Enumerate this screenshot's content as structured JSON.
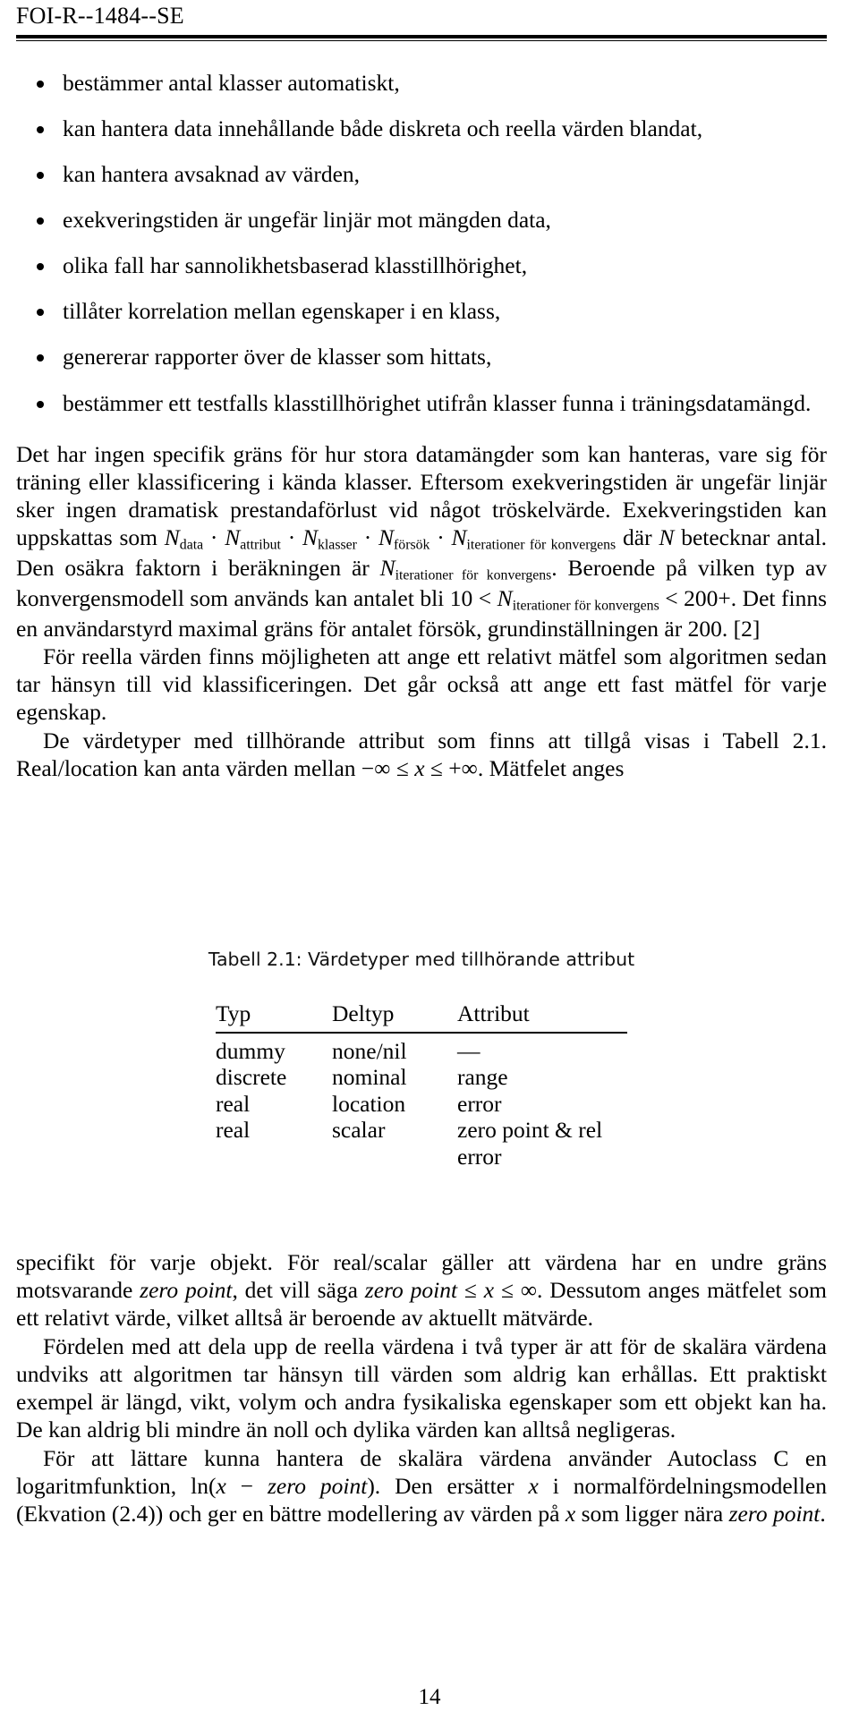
{
  "header": {
    "report_id": "FOI-R--1484--SE"
  },
  "bullets": [
    "bestämmer antal klasser automatiskt,",
    "kan hantera data innehållande både diskreta och reella värden blandat,",
    "kan hantera avsaknad av värden,",
    "exekveringstiden är ungefär linjär mot mängden data,",
    "olika fall har sannolikhetsbaserad klasstillhörighet,",
    "tillåter korrelation mellan egenskaper i en klass,",
    "genererar rapporter över de klasser som hittats,",
    "bestämmer ett testfalls klasstillhörighet utifrån klasser funna i träningsdatamängd."
  ],
  "paragraphs": {
    "p1_a": "Det har ingen specifik gräns för hur stora datamängder som kan hanteras, vare sig för träning eller klassificering i kända klasser. Eftersom exekveringstiden är ungefär linjär sker ingen dramatisk prestandaförlust vid något tröskelvärde. Exekveringstiden kan uppskattas som ",
    "p1_b": " där ",
    "p1_c": " betecknar antal. Den osäkra faktorn i beräkningen är ",
    "p1_d": ". Beroende på vilken typ av konvergensmodell som används kan antalet bli 10 < ",
    "p1_e": " < 200+. Det finns en användarstyrd maximal gräns för antalet försök, grundinställningen är 200. [2]",
    "p2": "För reella värden finns möjligheten att ange ett relativt mätfel som algoritmen sedan tar hänsyn till vid klassificeringen. Det går också att ange ett fast mätfel för varje egenskap.",
    "p3_a": "De värdetyper med tillhörande attribut som finns att tillgå visas i Tabell 2.1. Real/location kan anta värden mellan −∞ ≤ ",
    "p3_b": " ≤ +∞. Mätfelet anges",
    "p4_a": "specifikt för varje objekt. För real/scalar gäller att värdena har en undre gräns motsvarande ",
    "p4_b": ", det vill säga ",
    "p4_c": " ≤ ",
    "p4_d": " ≤ ∞. Dessutom anges mätfelet som ett relativt värde, vilket alltså är beroende av aktuellt mätvärde.",
    "p5": "Fördelen med att dela upp de reella värdena i två typer är att för de skalära värdena undviks att algoritmen tar hänsyn till värden som aldrig kan erhållas. Ett praktiskt exempel är längd, vikt, volym och andra fysikaliska egenskaper som ett objekt kan ha. De kan aldrig bli mindre än noll och dylika värden kan alltså negligeras.",
    "p6_a": "För att lättare kunna hantera de skalära värdena använder Autoclass C en logaritmfunktion, ln(",
    "p6_b": " − ",
    "p6_c": "). Den ersätter ",
    "p6_d": " i normalfördelningsmodellen (Ekvation (2.4)) och ger en bättre modellering av värden på ",
    "p6_e": " som ligger nära ",
    "p6_f": "."
  },
  "math": {
    "N": "N",
    "x": "x",
    "dot": "·",
    "zero_point": "zero point",
    "sub_data": "data",
    "sub_attribut": "attribut",
    "sub_klasser": "klasser",
    "sub_forsok": "försök",
    "sub_iterationer": "iterationer för konvergens"
  },
  "table": {
    "caption": "Tabell 2.1: Värdetyper med tillhörande attribut",
    "columns": [
      "Typ",
      "Deltyp",
      "Attribut"
    ],
    "rows": [
      [
        "dummy",
        "none/nil",
        "—"
      ],
      [
        "discrete",
        "nominal",
        "range"
      ],
      [
        "real",
        "location",
        "error"
      ],
      [
        "real",
        "scalar",
        "zero point & rel error"
      ]
    ]
  },
  "footer": {
    "page_number": "14"
  }
}
